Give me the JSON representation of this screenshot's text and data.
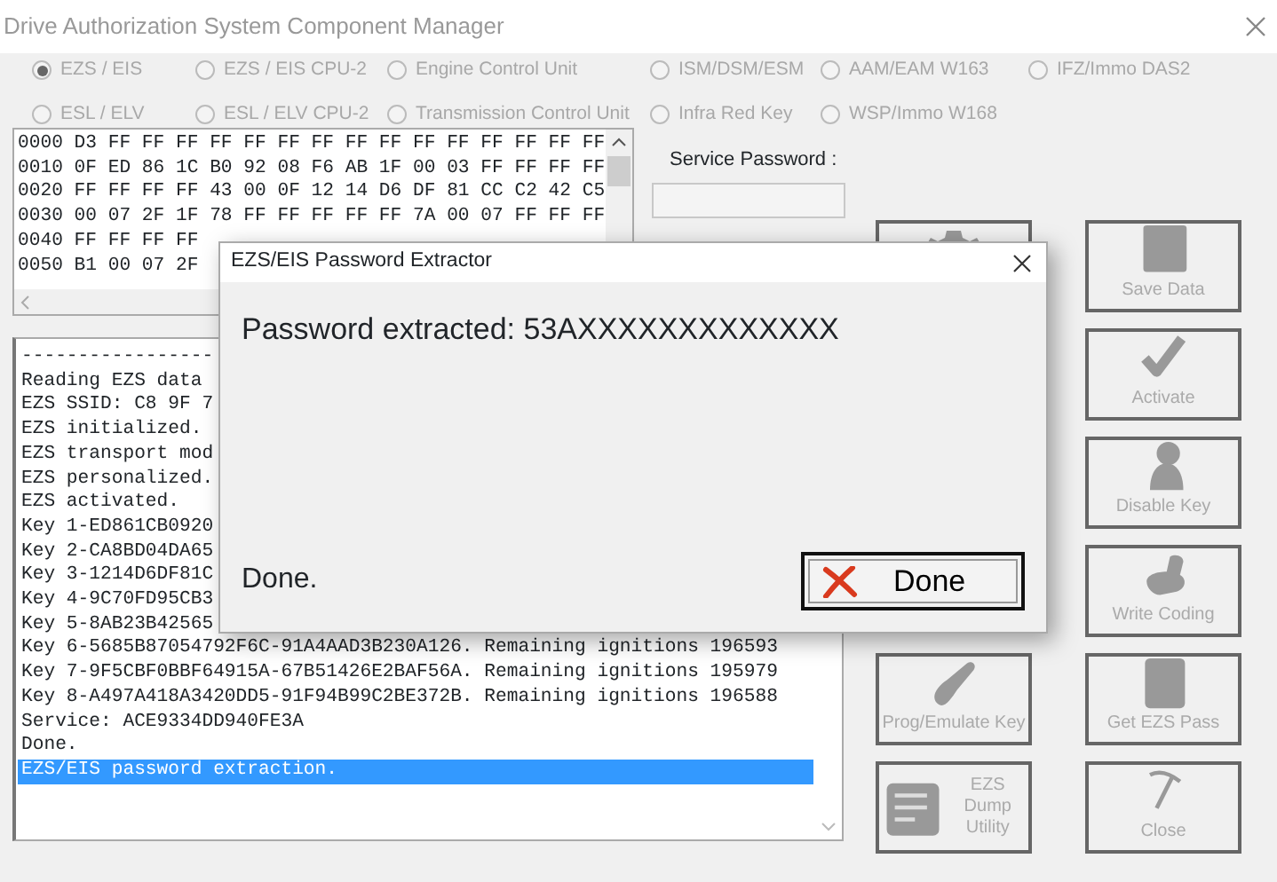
{
  "window": {
    "title": "Drive Authorization System Component Manager"
  },
  "modules": [
    {
      "label": "EZS / EIS",
      "selected": true,
      "disabled": true
    },
    {
      "label": "EZS / EIS CPU-2",
      "selected": false,
      "disabled": true
    },
    {
      "label": "Engine Control Unit",
      "selected": false,
      "disabled": true
    },
    {
      "label": "ISM/DSM/ESM",
      "selected": false,
      "disabled": true
    },
    {
      "label": "AAM/EAM W163",
      "selected": false,
      "disabled": true
    },
    {
      "label": "IFZ/Immo DAS2",
      "selected": false,
      "disabled": true
    },
    {
      "label": "ESL / ELV",
      "selected": false,
      "disabled": true
    },
    {
      "label": "ESL / ELV CPU-2",
      "selected": false,
      "disabled": true
    },
    {
      "label": "Transmission Control Unit",
      "selected": false,
      "disabled": true
    },
    {
      "label": "Infra Red Key",
      "selected": false,
      "disabled": true
    },
    {
      "label": "WSP/Immo W168",
      "selected": false,
      "disabled": true
    }
  ],
  "hex_dump": {
    "rows": [
      "0000 D3 FF FF FF FF FF FF FF FF FF FF FF FF FF FF FF",
      "0010 0F ED 86 1C B0 92 08 F6 AB 1F 00 03 FF FF FF FF",
      "0020 FF FF FF FF 43 00 0F 12 14 D6 DF 81 CC C2 42 C5",
      "0030 00 07 2F 1F 78 FF FF FF FF FF 7A 00 07 FF FF FF",
      "0040 FF FF FF FF",
      "0050 B1 00 07 2F"
    ]
  },
  "service_password": {
    "label": "Service Password :"
  },
  "log": [
    {
      "text": "-----------------",
      "selected": false
    },
    {
      "text": "Reading EZS data",
      "selected": false
    },
    {
      "text": "EZS SSID: C8 9F 7",
      "selected": false
    },
    {
      "text": "EZS initialized.",
      "selected": false
    },
    {
      "text": "EZS transport mod",
      "selected": false
    },
    {
      "text": "EZS personalized.",
      "selected": false
    },
    {
      "text": "EZS activated.",
      "selected": false
    },
    {
      "text": "Key 1-ED861CB0920",
      "selected": false
    },
    {
      "text": "Key 2-CA8BD04DA65",
      "selected": false
    },
    {
      "text": "Key 3-1214D6DF81C",
      "selected": false
    },
    {
      "text": "Key 4-9C70FD95CB3",
      "selected": false
    },
    {
      "text": "Key 5-8AB23B42565",
      "selected": false
    },
    {
      "text": "Key 6-5685B87054792F6C-91A4AAD3B230A126. Remaining ignitions 196593",
      "selected": false
    },
    {
      "text": "Key 7-9F5CBF0BBF64915A-67B51426E2BAF56A. Remaining ignitions 195979",
      "selected": false
    },
    {
      "text": "Key 8-A497A418A3420DD5-91F94B99C2BE372B. Remaining ignitions 196588",
      "selected": false
    },
    {
      "text": "Service: ACE9334DD940FE3A",
      "selected": false
    },
    {
      "text": "Done.",
      "selected": false
    },
    {
      "text": "EZS/EIS password extraction.",
      "selected": true
    }
  ],
  "left_buttons": [
    {
      "kind": "gear",
      "disabled": true
    },
    {
      "label": "Prog/Emulate Key",
      "kind": "fob",
      "disabled": true
    },
    {
      "label": "EZS Dump Utility",
      "kind": "chip",
      "disabled": true
    }
  ],
  "right_buttons": [
    {
      "label": "Save Data",
      "kind": "floppy",
      "disabled": true
    },
    {
      "label": "Activate",
      "kind": "check",
      "disabled": true
    },
    {
      "label": "Disable Key",
      "kind": "figure",
      "disabled": true
    },
    {
      "label": "Write Coding",
      "kind": "hand",
      "disabled": true
    },
    {
      "label": "Get EZS Pass",
      "kind": "card",
      "disabled": true
    },
    {
      "label": "Close",
      "kind": "pick",
      "disabled": true
    }
  ],
  "dialog": {
    "title": "EZS/EIS Password Extractor",
    "message": "Password extracted: 53AXXXXXXXXXXXXX",
    "status": "Done.",
    "button": "Done"
  }
}
